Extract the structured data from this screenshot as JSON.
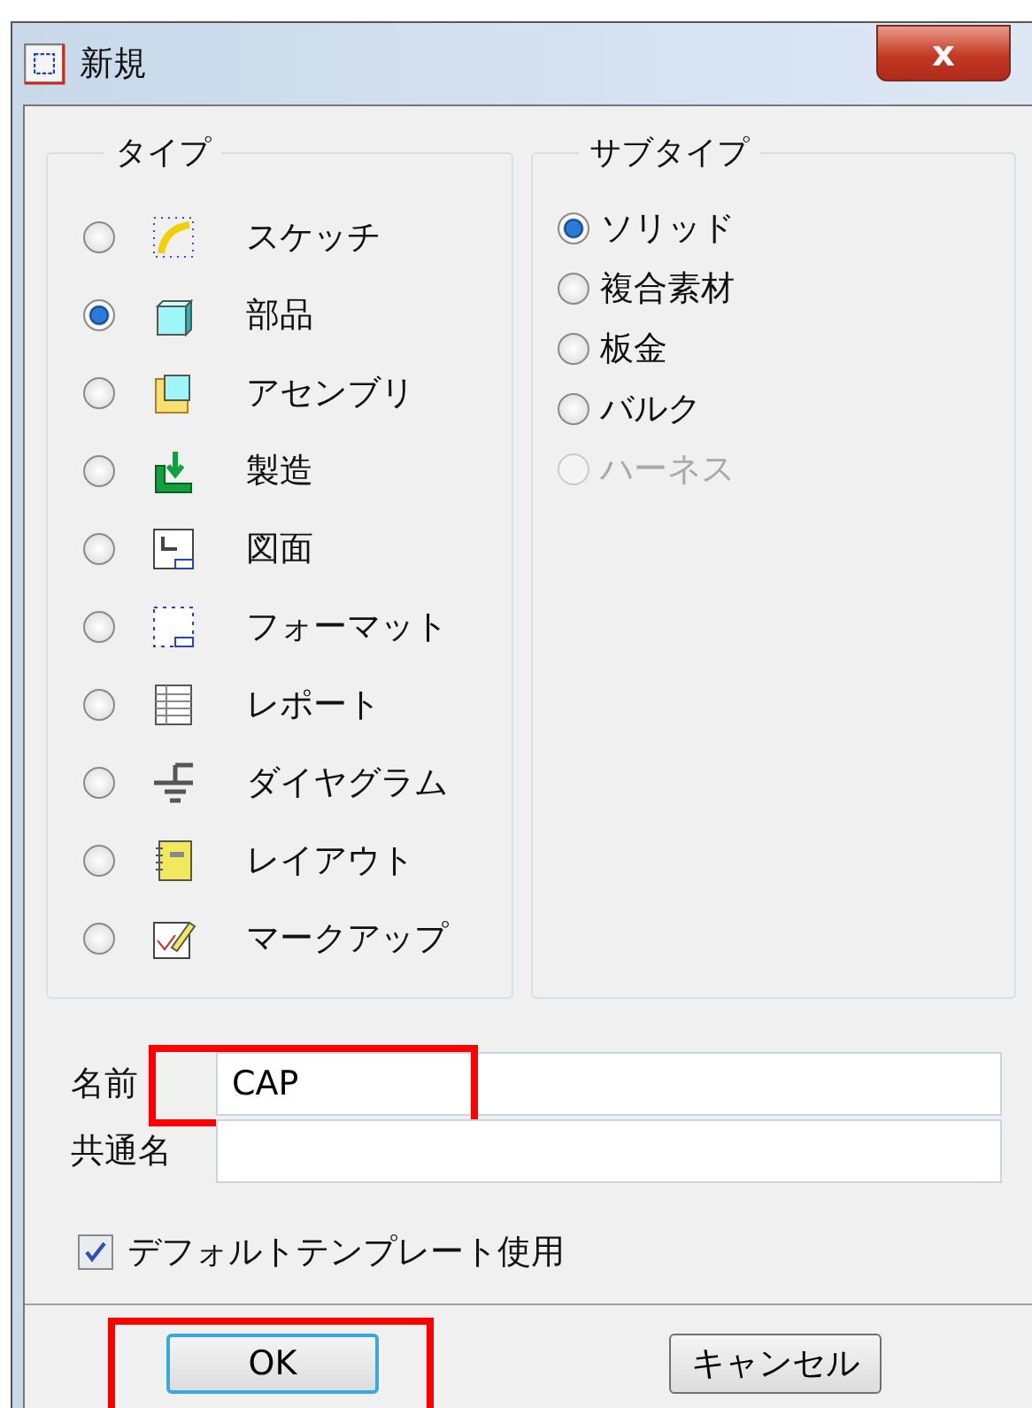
{
  "window": {
    "title": "新規",
    "close": "x"
  },
  "type_group": {
    "label": "タイプ",
    "items": [
      {
        "label": "スケッチ",
        "selected": false
      },
      {
        "label": "部品",
        "selected": true
      },
      {
        "label": "アセンブリ",
        "selected": false
      },
      {
        "label": "製造",
        "selected": false
      },
      {
        "label": "図面",
        "selected": false
      },
      {
        "label": "フォーマット",
        "selected": false
      },
      {
        "label": "レポート",
        "selected": false
      },
      {
        "label": "ダイヤグラム",
        "selected": false
      },
      {
        "label": "レイアウト",
        "selected": false
      },
      {
        "label": "マークアップ",
        "selected": false
      }
    ]
  },
  "subtype_group": {
    "label": "サブタイプ",
    "items": [
      {
        "label": "ソリッド",
        "selected": true,
        "disabled": false
      },
      {
        "label": "複合素材",
        "selected": false,
        "disabled": false
      },
      {
        "label": "板金",
        "selected": false,
        "disabled": false
      },
      {
        "label": "バルク",
        "selected": false,
        "disabled": false
      },
      {
        "label": "ハーネス",
        "selected": false,
        "disabled": true
      }
    ]
  },
  "fields": [
    {
      "label": "名前",
      "value": "CAP"
    },
    {
      "label": "共通名"
    }
  ],
  "default_template": {
    "label": "デフォルトテンプレート使用",
    "checked": true
  },
  "buttons": [
    {
      "label": "OK",
      "default": true
    },
    {
      "label": "キャンセル",
      "default": false
    }
  ]
}
